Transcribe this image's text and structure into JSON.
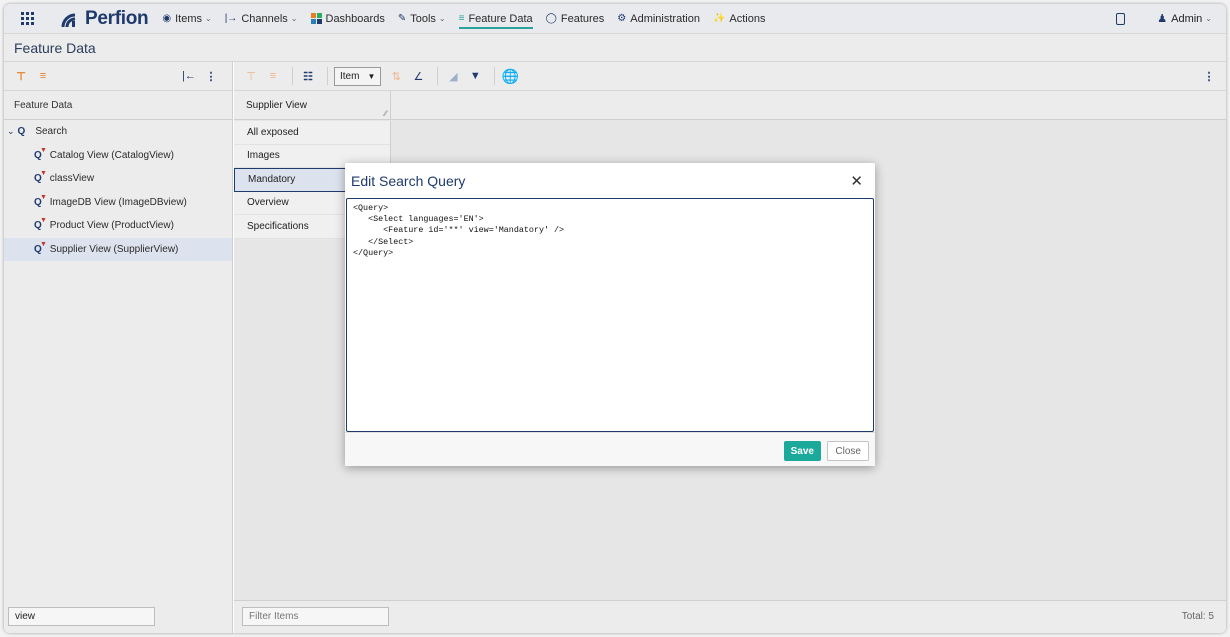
{
  "brand": {
    "name": "Perfion",
    "color": "#1f3a6d"
  },
  "nav": {
    "items": [
      {
        "label": "Items",
        "icon": "cube-icon",
        "dropdown": true
      },
      {
        "label": "Channels",
        "icon": "channels-icon",
        "dropdown": true
      },
      {
        "label": "Dashboards",
        "icon": "dashboard-icon",
        "dropdown": false
      },
      {
        "label": "Tools",
        "icon": "wrench-icon",
        "dropdown": true
      },
      {
        "label": "Feature Data",
        "icon": "feature-data-icon",
        "dropdown": false,
        "active": true
      },
      {
        "label": "Features",
        "icon": "database-icon",
        "dropdown": false
      },
      {
        "label": "Administration",
        "icon": "gear-icon",
        "dropdown": false
      },
      {
        "label": "Actions",
        "icon": "actions-icon",
        "dropdown": false
      }
    ],
    "user": "Admin"
  },
  "page": {
    "title": "Feature Data"
  },
  "left": {
    "header": "Feature Data",
    "root": "Search",
    "children": [
      "Catalog View (CatalogView)",
      "classView",
      "ImageDB View (ImageDBview)",
      "Product View (ProductView)",
      "Supplier View (SupplierView)"
    ],
    "selected_index": 4,
    "search_value": "view"
  },
  "right": {
    "item_selector": "Item",
    "column_header": "Supplier View",
    "list": [
      "All exposed",
      "Images",
      "Mandatory",
      "Overview",
      "Specifications"
    ],
    "selected_index": 2,
    "filter_placeholder": "Filter Items",
    "total": "Total: 5"
  },
  "modal": {
    "title": "Edit Search Query",
    "query": "<Query>\n   <Select languages='EN'>\n      <Feature id='**' view='Mandatory' />\n   </Select>\n</Query>",
    "save_label": "Save",
    "close_label": "Close",
    "accent": "#1aa99b"
  }
}
